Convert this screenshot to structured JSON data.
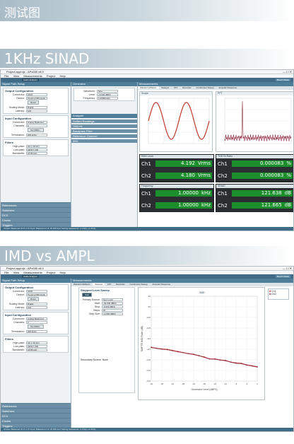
{
  "heading": {
    "main": "测试图"
  },
  "sections": [
    {
      "title": "1KHz SINAD"
    },
    {
      "title": "IMD vs AMPL"
    }
  ],
  "app": {
    "title": "Project.approjx - APx555 v8.0",
    "menu": [
      "File",
      "View",
      "Measurements",
      "Project",
      "Help"
    ],
    "toolbar": {
      "mode": "Audio Analyzer",
      "batch": "Bench Mode"
    },
    "status": "Output: Balanced OUT 2 ch  Input: Balanced 2 ch  20.000 kHz  Setting Sequencer: 1 Ch(s)  +1 Ch(s)"
  },
  "left_panel": {
    "header": "Signal Path Setup",
    "output_group": {
      "title": "Output Configuration",
      "rows": [
        {
          "label": "Connector:",
          "value": "ASIO"
        },
        {
          "label": "Device:",
          "value": "Topping D90 Audio"
        },
        {
          "label": "Scaling Mode:",
          "value": "Digital"
        },
        {
          "label": "Latency:",
          "value": "100"
        }
      ],
      "button": "Reset"
    },
    "input_group": {
      "title": "Input Configuration",
      "rows": [
        {
          "label": "Connector:",
          "value": "Analog Balanced"
        },
        {
          "label": "Channels:",
          "value": "2"
        },
        {
          "label": "Termination:",
          "value": "200 kohm"
        }
      ],
      "button": "Set 600Ω..."
    },
    "filter_group": {
      "title": "Filters",
      "rows": [
        {
          "label": "High-pass:",
          "value": "AC (<10 Hz)"
        },
        {
          "label": "Low-pass:",
          "value": "AES17-20k"
        },
        {
          "label": "Bandwidth:",
          "value": "22.86 kHz"
        }
      ]
    },
    "nav": [
      "References",
      "Switchers",
      "DCX",
      "Clocks",
      "Triggers"
    ]
  },
  "generator_1": {
    "header": "Generator",
    "rows": [
      {
        "label": "Waveform:",
        "value": "Sine"
      },
      {
        "label": "Level:",
        "value": "+0.000 dBFS"
      },
      {
        "label": "Frequency:",
        "value": "1.00000 kHz"
      }
    ],
    "analyzer": "Analyzer",
    "sections": [
      "Settled Readings",
      "THD+N",
      "Bandpass Filter",
      "Reference Channel",
      "IMD"
    ]
  },
  "measurements_1": {
    "header": "Measurements",
    "tabs": [
      "Waveform/Meters",
      "Sweeps",
      "FFT",
      "Recorder",
      "Continuous Sweep",
      "Acoustic Response"
    ],
    "graph_left": "Scope",
    "graph_right": "FFT",
    "meters": [
      {
        "title": "RMS Level",
        "ch1": "4.192",
        "ch2": "4.180",
        "unit": "Vrms"
      },
      {
        "title": "THD+N Ratio",
        "ch1": "0.000083",
        "ch2": "0.000083",
        "unit": "%"
      },
      {
        "title": "Frequency",
        "ch1": "1.00000",
        "ch2": "1.00000",
        "unit": "kHz"
      },
      {
        "title": "SINAD",
        "ch1": "121.638",
        "ch2": "121.665",
        "unit": "dB"
      }
    ]
  },
  "sweep_panel": {
    "header": "Stepped Level Sweep",
    "rows": [
      {
        "label": "Primary Source:",
        "value": "Gen Level"
      },
      {
        "label": "Start:",
        "value": "-40.000 dBFS"
      },
      {
        "label": "Stop:",
        "value": "-0.000 dBFS"
      },
      {
        "label": "Steps:",
        "value": "20"
      },
      {
        "label": "Step Size:",
        "value": "+1.000 dBFS"
      }
    ],
    "start_button": "Start",
    "secondary": "Secondary Source:  None"
  },
  "plot_2": {
    "title": "IMD",
    "xlabel": "Generator Level (dBFS)",
    "ylabel": "SMPTE IMD Ratio (dB)",
    "legend": [
      "Ch1",
      "Ch2"
    ]
  },
  "chart_data": {
    "type": "line",
    "title": "IMD",
    "xlabel": "Generator Level (dBFS)",
    "ylabel": "SMPTE IMD Ratio (dB)",
    "xlim": [
      -40,
      0
    ],
    "ylim": [
      -130,
      -90
    ],
    "x": [
      -40,
      -38,
      -36,
      -34,
      -32,
      -30,
      -28,
      -26,
      -24,
      -22,
      -20,
      -18,
      -16,
      -14,
      -12,
      -10,
      -8,
      -6,
      -4,
      -2,
      0
    ],
    "series": [
      {
        "name": "Ch1",
        "values": [
          -114,
          -114.5,
          -114.8,
          -115,
          -115.5,
          -116,
          -116.5,
          -117,
          -117.3,
          -118,
          -118.6,
          -119.5,
          -119.5,
          -120,
          -120.2,
          -121,
          -121.4,
          -121.6,
          -122.3,
          -122.7,
          -123.2
        ]
      },
      {
        "name": "Ch2",
        "values": [
          -114.2,
          -114.6,
          -115,
          -115.2,
          -115.7,
          -116.2,
          -116.6,
          -117.1,
          -117.5,
          -118.1,
          -118.8,
          -119.6,
          -119.7,
          -120.1,
          -120.4,
          -121.1,
          -121.6,
          -121.8,
          -122.5,
          -122.9,
          -123.4
        ]
      }
    ]
  },
  "colors": {
    "accent": "#4e7e9a",
    "meter_green": "#1a8f2b",
    "ch1": "#c0392b",
    "ch2": "#8e2b40"
  }
}
